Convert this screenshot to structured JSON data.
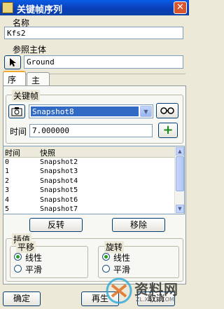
{
  "window": {
    "title": "关键帧序列",
    "close_label": "✕"
  },
  "name_section": {
    "label": "名称",
    "value": "Kfs2"
  },
  "reference_section": {
    "label": "参照主体",
    "value": "Ground"
  },
  "tabs": [
    {
      "label": "序列"
    },
    {
      "label": "主体"
    }
  ],
  "keyframe_group": {
    "title": "关键帧",
    "snapshot_selected": "Snapshot8",
    "time_label": "时间",
    "time_value": "7.000000",
    "add_label": "+"
  },
  "table": {
    "headers": [
      "时间",
      "快照"
    ],
    "rows": [
      {
        "time": "0",
        "snapshot": "Snapshot2"
      },
      {
        "time": "1",
        "snapshot": "Snapshot3"
      },
      {
        "time": "2",
        "snapshot": "Snapshot4"
      },
      {
        "time": "3",
        "snapshot": "Snapshot5"
      },
      {
        "time": "4",
        "snapshot": "Snapshot6"
      },
      {
        "time": "5",
        "snapshot": "Snapshot7"
      }
    ]
  },
  "list_buttons": {
    "reverse": "反转",
    "remove": "移除"
  },
  "interpolation": {
    "title": "插值",
    "translate": {
      "title": "平移",
      "option1": "线性",
      "option2": "平滑",
      "selected": "线性"
    },
    "rotate": {
      "title": "旋转",
      "option1": "线性",
      "option2": "平滑",
      "selected": "线性"
    }
  },
  "footer": {
    "ok": "确定",
    "regenerate": "再生",
    "cancel": "取消"
  },
  "watermark": {
    "site": "资料网",
    "url": "ZL.XS1X.COM"
  }
}
